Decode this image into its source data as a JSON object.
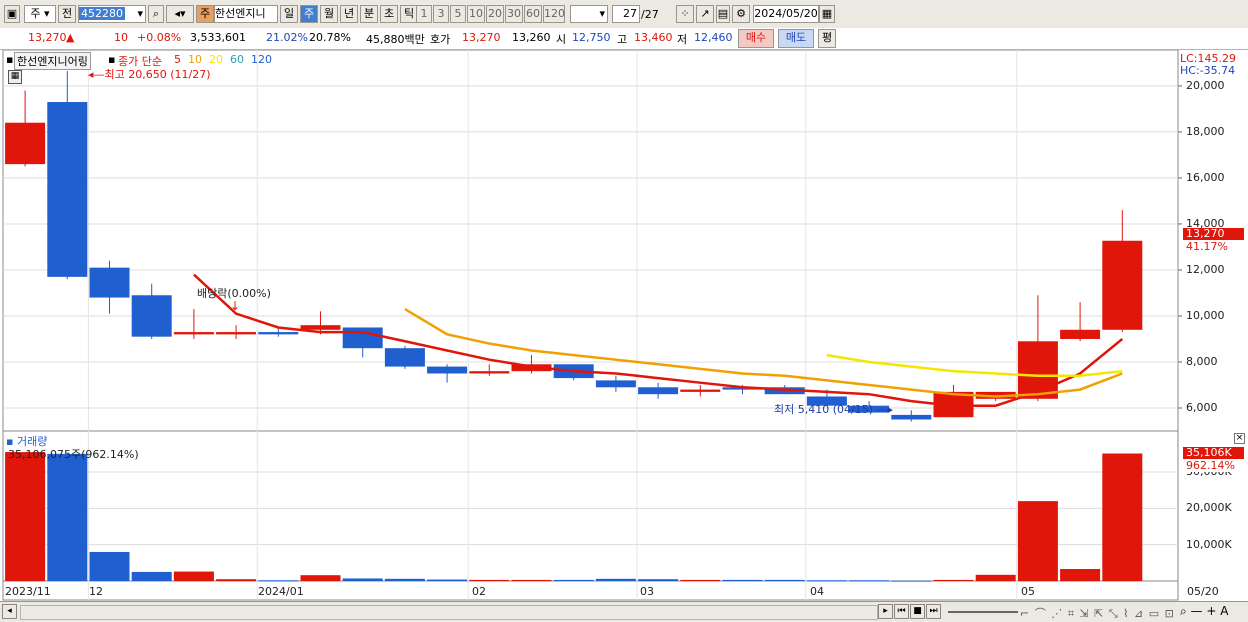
{
  "toolbar": {
    "market": "주",
    "all": "전",
    "code": "452280",
    "stock_name": "한선엔지니",
    "periods": [
      "일",
      "주",
      "월",
      "년",
      "분",
      "초",
      "틱"
    ],
    "active_period": "주",
    "intervals": [
      "1",
      "3",
      "5",
      "10",
      "20",
      "30",
      "60",
      "120"
    ],
    "count": "27",
    "count_total": "/27",
    "date": "2024/05/20",
    "pay_label": "주"
  },
  "quote": {
    "price": "13,270",
    "arrow": "▲",
    "change": "10",
    "change_pct": "+0.08%",
    "volume": "3,533,601",
    "ratio1": "21.02%",
    "ratio2": "20.78%",
    "amount": "45,880백만",
    "bid_label": "호가",
    "bid": "13,270",
    "ask": "13,260",
    "open_label": "시",
    "open": "12,750",
    "high_label": "고",
    "high": "13,460",
    "low_label": "저",
    "low": "12,460",
    "buy": "매수",
    "sell": "매도",
    "eval": "평"
  },
  "price_pane": {
    "name_box": "한선엔지니어링",
    "legend_title": "종가 단순",
    "ma_periods": [
      "5",
      "10",
      "20",
      "60",
      "120"
    ],
    "ma_colors": [
      "#e0160b",
      "#f0a000",
      "#f5e600",
      "#2aa0b0",
      "#1f5fd0"
    ],
    "high_note": "최고 20,650 (11/27)",
    "low_note": "최저 5,410 (04/15)",
    "dividend_note": "배당락(0.00%)",
    "lc": "LC:145.29",
    "hc": "HC:-35.74",
    "current_tag": "13,270",
    "current_pct": "41.17%",
    "yticks": [
      "20,000",
      "18,000",
      "16,000",
      "14,000",
      "12,000",
      "10,000",
      "8,000",
      "6,000"
    ]
  },
  "volume_pane": {
    "title": "거래량",
    "readout": "35,106,075주(962.14%)",
    "current_tag": "35,106K",
    "current_pct": "962.14%",
    "yticks": [
      "30,000K",
      "20,000K",
      "10,000K"
    ]
  },
  "xaxis": [
    "2023/11",
    "12",
    "2024/01",
    "02",
    "03",
    "04",
    "05",
    "05/20"
  ],
  "chart_data": {
    "type": "candlestick",
    "x": [
      "2023-11-20",
      "2023-11-27",
      "2023-12-04",
      "2023-12-11",
      "2023-12-18",
      "2023-12-25",
      "2024-01-01",
      "2024-01-08",
      "2024-01-15",
      "2024-01-22",
      "2024-01-29",
      "2024-02-05",
      "2024-02-12",
      "2024-02-19",
      "2024-02-26",
      "2024-03-04",
      "2024-03-11",
      "2024-03-18",
      "2024-03-25",
      "2024-04-01",
      "2024-04-08",
      "2024-04-15",
      "2024-04-22",
      "2024-04-29",
      "2024-05-06",
      "2024-05-13",
      "2024-05-20"
    ],
    "open": [
      16600,
      19300,
      12100,
      10900,
      9200,
      9200,
      9300,
      9400,
      9500,
      8600,
      7800,
      7500,
      7600,
      7900,
      7200,
      6900,
      6700,
      6900,
      6900,
      6500,
      6100,
      5700,
      5600,
      6400,
      6400,
      9000,
      9400
    ],
    "high": [
      19800,
      20650,
      12400,
      11400,
      10300,
      9600,
      9500,
      10200,
      9500,
      8700,
      7900,
      7900,
      8300,
      7900,
      7400,
      7100,
      7000,
      7000,
      7000,
      6800,
      6300,
      5900,
      7000,
      6700,
      10900,
      10600,
      14600
    ],
    "low": [
      16500,
      11600,
      10100,
      9000,
      9000,
      9000,
      9100,
      9200,
      8200,
      7700,
      7100,
      7400,
      7500,
      7200,
      6700,
      6400,
      6500,
      6600,
      6600,
      6200,
      5900,
      5410,
      5600,
      6300,
      6300,
      8900,
      9300
    ],
    "close": [
      18400,
      11700,
      10800,
      9100,
      9300,
      9300,
      9200,
      9600,
      8600,
      7800,
      7500,
      7600,
      7900,
      7300,
      6900,
      6600,
      6800,
      6800,
      6600,
      6100,
      5800,
      5500,
      6700,
      6700,
      8900,
      9400,
      13270
    ],
    "volume": [
      35500,
      35000,
      8000,
      2500,
      2600,
      500,
      200,
      1600,
      700,
      600,
      400,
      300,
      300,
      300,
      600,
      500,
      300,
      300,
      300,
      200,
      200,
      100,
      300,
      1700,
      22000,
      3300,
      35106
    ],
    "ma5": [
      null,
      null,
      null,
      null,
      11800,
      10100,
      9500,
      9300,
      9300,
      8900,
      8500,
      8100,
      7800,
      7600,
      7500,
      7300,
      7100,
      6900,
      6800,
      6700,
      6600,
      6300,
      6100,
      6100,
      6700,
      7500,
      9000
    ],
    "ma10": [
      null,
      null,
      null,
      null,
      null,
      null,
      null,
      null,
      null,
      10300,
      9200,
      8800,
      8500,
      8300,
      8100,
      7900,
      7700,
      7500,
      7400,
      7200,
      7000,
      6800,
      6600,
      6500,
      6600,
      6800,
      7500
    ],
    "ma20": [
      null,
      null,
      null,
      null,
      null,
      null,
      null,
      null,
      null,
      null,
      null,
      null,
      null,
      null,
      null,
      null,
      null,
      null,
      null,
      8300,
      8000,
      7800,
      7600,
      7500,
      7400,
      7400,
      7600
    ],
    "ylim": [
      5000,
      21300
    ],
    "volume_ylim": [
      0,
      38000
    ],
    "colors": {
      "up": "#e0160b",
      "down": "#1f5fd0"
    }
  }
}
